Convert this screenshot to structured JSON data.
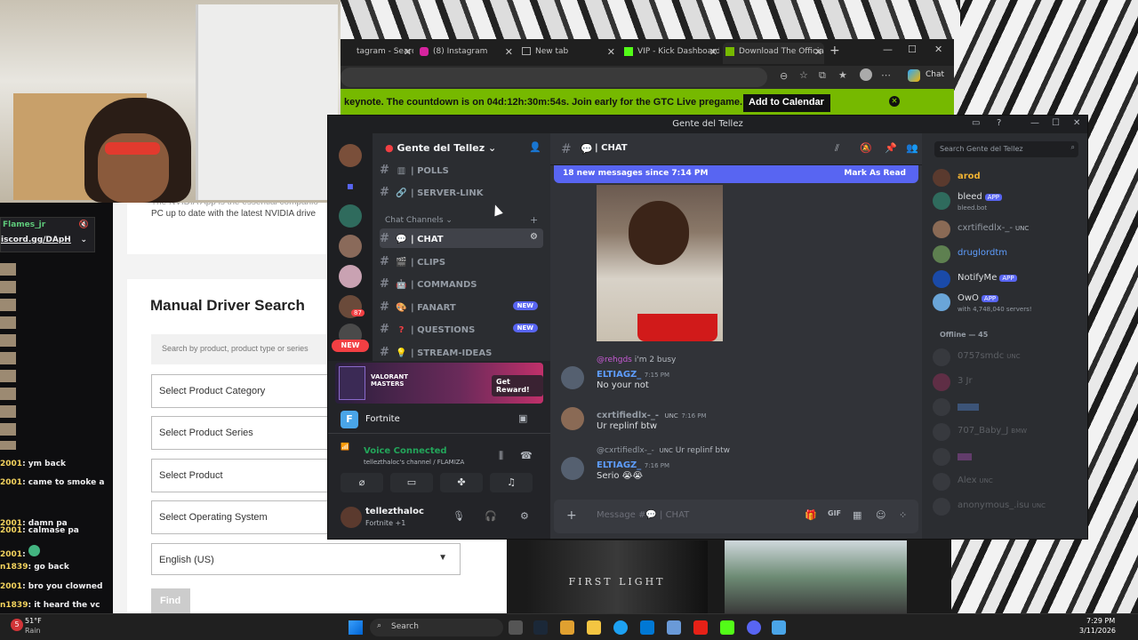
{
  "browser": {
    "tabs": [
      {
        "label": "tagram - Search"
      },
      {
        "label": "(8) Instagram"
      },
      {
        "label": "New tab"
      },
      {
        "label": "VIP - Kick Dashboard"
      },
      {
        "label": "Download The Officia"
      }
    ],
    "chat_button": "Chat",
    "banner_text": "keynote. The countdown is on 04d:12h:30m:54s. Join early for the GTC Live pregame.",
    "banner_cta": "Add to Calendar"
  },
  "nvidia": {
    "intro_text": "PC up to date with the latest NVIDIA drive",
    "intro_text_top": "The NVIDIA App is the essential companio",
    "section_title": "Manual Driver Search",
    "search_placeholder": "Search by product, product type or series",
    "selects": [
      "Select Product Category",
      "Select Product Series",
      "Select Product",
      "Select Operating System"
    ],
    "language": "English (US)",
    "find_button": "Find"
  },
  "twitch": {
    "header_user": "Flames_jr",
    "header_link": "iscord.gg/DApH",
    "lines": [
      {
        "user": "2001",
        "text": "ym back"
      },
      {
        "user": "2001",
        "text": "came to smoke a"
      },
      {
        "user": "2001",
        "text": "damn pa"
      },
      {
        "user": "2001",
        "text": "calmase pa"
      },
      {
        "user": "2001",
        "text": ""
      },
      {
        "user": "n1839",
        "text": "go back"
      },
      {
        "user": "2001",
        "text": "bro you clowned"
      },
      {
        "user": "n1839",
        "text": "it heard the vc"
      }
    ]
  },
  "discord": {
    "window_title": "Gente del Tellez",
    "server_name": "Gente del Tellez",
    "server_badge": "87",
    "new_badge": "NEW",
    "channels_top": [
      {
        "name": "| POLLS",
        "icon": "chart-icon"
      },
      {
        "name": "| SERVER-LINK",
        "icon": "link-icon"
      }
    ],
    "category": "Chat Channels",
    "channels": [
      {
        "name": "| CHAT",
        "icon": "speech-icon",
        "badge": ""
      },
      {
        "name": "| CLIPS",
        "icon": "clapper-icon",
        "badge": ""
      },
      {
        "name": "| COMMANDS",
        "icon": "robot-icon",
        "badge": ""
      },
      {
        "name": "| FANART",
        "icon": "palette-icon",
        "badge": "NEW"
      },
      {
        "name": "| QUESTIONS",
        "icon": "question-icon",
        "badge": "NEW"
      },
      {
        "name": "| STREAM-IDEAS",
        "icon": "bulb-icon",
        "badge": ""
      }
    ],
    "reward": {
      "game": "VALORANT MASTERS",
      "button": "Get Reward!"
    },
    "activity": "Fortnite",
    "voice": {
      "status": "Voice Connected",
      "channel": "tellezthaloc's channel / FLAMIZA"
    },
    "user": {
      "name": "tellezthaloc",
      "status": "Fortnite +1"
    },
    "chat_header": "| CHAT",
    "new_messages": "18 new messages since 7:14 PM",
    "mark_read": "Mark As Read",
    "messages": [
      {
        "reply_to": "@rehgds",
        "reply_text": "i'm 2 busy",
        "author": "ELTIAGZ_",
        "time": "7:15 PM",
        "text": "No your not"
      },
      {
        "author": "cxrtifiedlx-_-",
        "tag": "UNC",
        "time": "7:16 PM",
        "text": "Ur replinf btw"
      },
      {
        "reply_to": "@cxrtifiedlx-_-",
        "reply_tag": "UNC",
        "reply_text": "Ur replinf btw",
        "author": "ELTIAGZ_",
        "time": "7:16 PM",
        "text": "Serio 😭😭"
      }
    ],
    "composer_placeholder": "Message #💬 | CHAT",
    "search_placeholder": "Search Gente del Tellez",
    "members_online": [
      {
        "name": "arod",
        "color": "#f0b232",
        "app": "",
        "sub": "",
        "tag": ""
      },
      {
        "name": "bleed",
        "color": "#dbdee1",
        "app": "APP",
        "sub": "bleed.bot",
        "tag": ""
      },
      {
        "name": "cxrtifiedlx-_-",
        "color": "#dbdee1",
        "app": "",
        "sub": "",
        "tag": "UNC"
      },
      {
        "name": "druglordtm",
        "color": "#5e9dfd",
        "app": "",
        "sub": "",
        "tag": ""
      },
      {
        "name": "NotifyMe",
        "color": "#dbdee1",
        "app": "APP",
        "sub": "",
        "tag": ""
      },
      {
        "name": "OwO",
        "color": "#dbdee1",
        "app": "APP",
        "sub": "with 4,748,040 servers!",
        "tag": ""
      }
    ],
    "offline_header": "Offline — 45",
    "members_offline": [
      {
        "name": "0757smdc",
        "tag": "UNC"
      },
      {
        "name": "3 Jr",
        "tag": ""
      },
      {
        "name": "",
        "tag": ""
      },
      {
        "name": "707_Baby_J",
        "tag": "BMW"
      },
      {
        "name": "",
        "tag": ""
      },
      {
        "name": "Alex",
        "tag": "UNC"
      },
      {
        "name": "anonymous_.isu",
        "tag": "UNC"
      }
    ]
  },
  "thumbs": {
    "first_light": "FIRST LIGHT"
  },
  "taskbar": {
    "weather_temp": "51°F",
    "weather_desc": "Rain",
    "weather_badge": "5",
    "search": "Search",
    "time": "7:29 PM",
    "date": "3/11/2026"
  }
}
